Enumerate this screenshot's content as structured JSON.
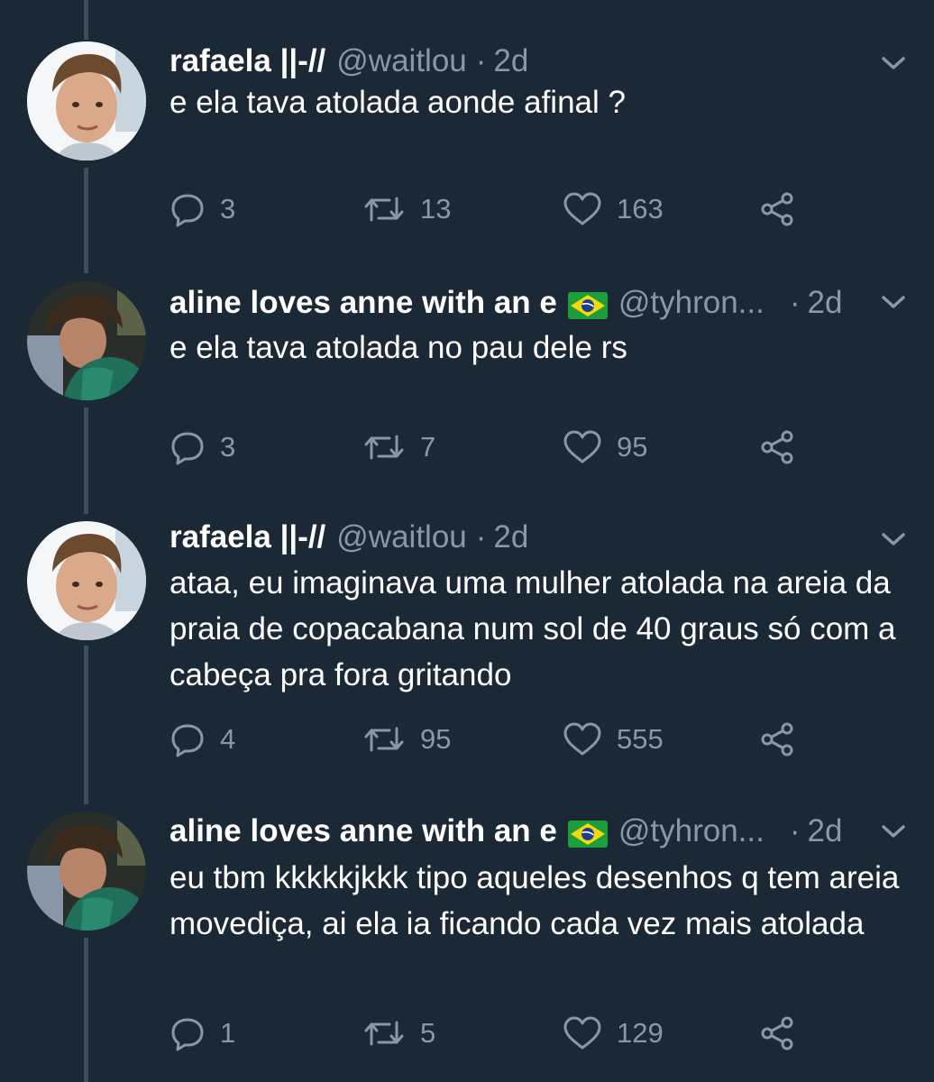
{
  "tweets": [
    {
      "name": "rafaela ||-//",
      "handle": "@waitlou",
      "dot": "·",
      "time": "2d",
      "text": "e ela tava atolada aonde afinal ?",
      "replies": "3",
      "retweets": "13",
      "likes": "163",
      "flag": false
    },
    {
      "name": "aline loves anne with an e",
      "handle": "@tyhron...",
      "dot": "·",
      "time": "2d",
      "text": "e ela tava atolada no pau dele rs",
      "replies": "3",
      "retweets": "7",
      "likes": "95",
      "flag": true
    },
    {
      "name": "rafaela ||-//",
      "handle": "@waitlou",
      "dot": "·",
      "time": "2d",
      "text": "ataa, eu imaginava uma mulher atolada na areia da praia de copacabana num sol de 40 graus só com a cabeça pra fora gritando",
      "replies": "4",
      "retweets": "95",
      "likes": "555",
      "flag": false
    },
    {
      "name": "aline loves anne with an e",
      "handle": "@tyhron...",
      "dot": "·",
      "time": "2d",
      "text": "eu tbm kkkkkjkkk tipo aqueles desenhos q tem areia movediça, ai ela ia ficando cada vez mais atolada",
      "replies": "1",
      "retweets": "5",
      "likes": "129",
      "flag": true
    }
  ],
  "icons": {
    "reply": "reply-icon",
    "retweet": "retweet-icon",
    "like": "heart-icon",
    "share": "share-icon",
    "caret": "chevron-down-icon",
    "flag": "brazil-flag-icon"
  },
  "colors": {
    "background": "#1b2836",
    "text": "#ffffff",
    "muted": "#8899a6",
    "thread_line": "#3c4d5e"
  }
}
